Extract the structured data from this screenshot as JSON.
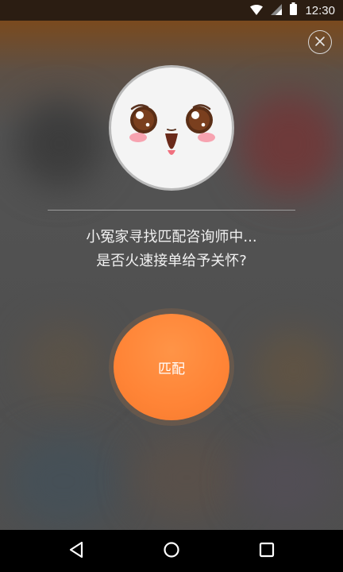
{
  "status_bar": {
    "time": "12:30",
    "icons": [
      "wifi-icon",
      "signal-icon",
      "battery-icon"
    ]
  },
  "dialog": {
    "close_icon": "close-icon",
    "avatar": "cute-face-mascot",
    "message_line1": "小冤家寻找匹配咨询师中...",
    "message_line2": "是否火速接单给予关怀?",
    "match_button_label": "匹配"
  },
  "nav_bar": {
    "icons": [
      "back-icon",
      "home-icon",
      "recents-icon"
    ]
  },
  "colors": {
    "accent": "#ff8436",
    "overlay": "#4e4e4e"
  }
}
